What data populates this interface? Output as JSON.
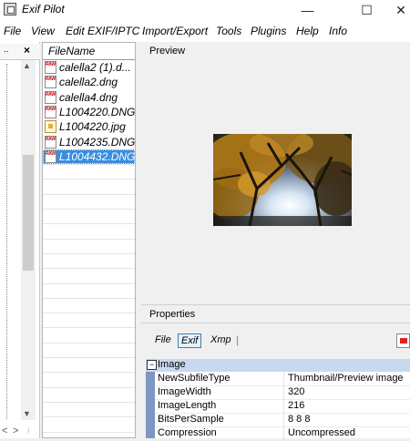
{
  "window": {
    "title": "Exif Pilot",
    "minimize": "—",
    "maximize": "☐",
    "close": "✕"
  },
  "menu": [
    "File",
    "View",
    "Edit EXIF/IPTC",
    "Import/Export",
    "Tools",
    "Plugins",
    "Help",
    "Info"
  ],
  "left_panel": {
    "header": "..",
    "close": "×"
  },
  "file_list": {
    "header": "FileName",
    "files": [
      {
        "name": "calella2 (1).d...",
        "type": "raw"
      },
      {
        "name": "calella2.dng",
        "type": "raw"
      },
      {
        "name": "calella4.dng",
        "type": "raw"
      },
      {
        "name": "L1004220.DNG",
        "type": "raw"
      },
      {
        "name": "L1004220.jpg",
        "type": "jpg"
      },
      {
        "name": "L1004235.DNG",
        "type": "raw"
      },
      {
        "name": "L1004432.DNG",
        "type": "raw",
        "selected": true
      }
    ]
  },
  "preview": {
    "label": "Preview"
  },
  "properties": {
    "label": "Properties",
    "tabs": [
      "File",
      "Exif",
      "Xmp"
    ],
    "active_tab": "Exif",
    "tab_separator": "|",
    "group": "Image",
    "group_toggle": "−",
    "rows": [
      {
        "key": "NewSubfileType",
        "value": "Thumbnail/Preview image"
      },
      {
        "key": "ImageWidth",
        "value": "320"
      },
      {
        "key": "ImageLength",
        "value": "216"
      },
      {
        "key": "BitsPerSample",
        "value": "8 8 8"
      },
      {
        "key": "Compression",
        "value": "Uncompressed"
      }
    ]
  },
  "scroll": {
    "up": "▲",
    "down": "▼",
    "left": "<",
    "right": ">",
    "grip": "⁞"
  }
}
